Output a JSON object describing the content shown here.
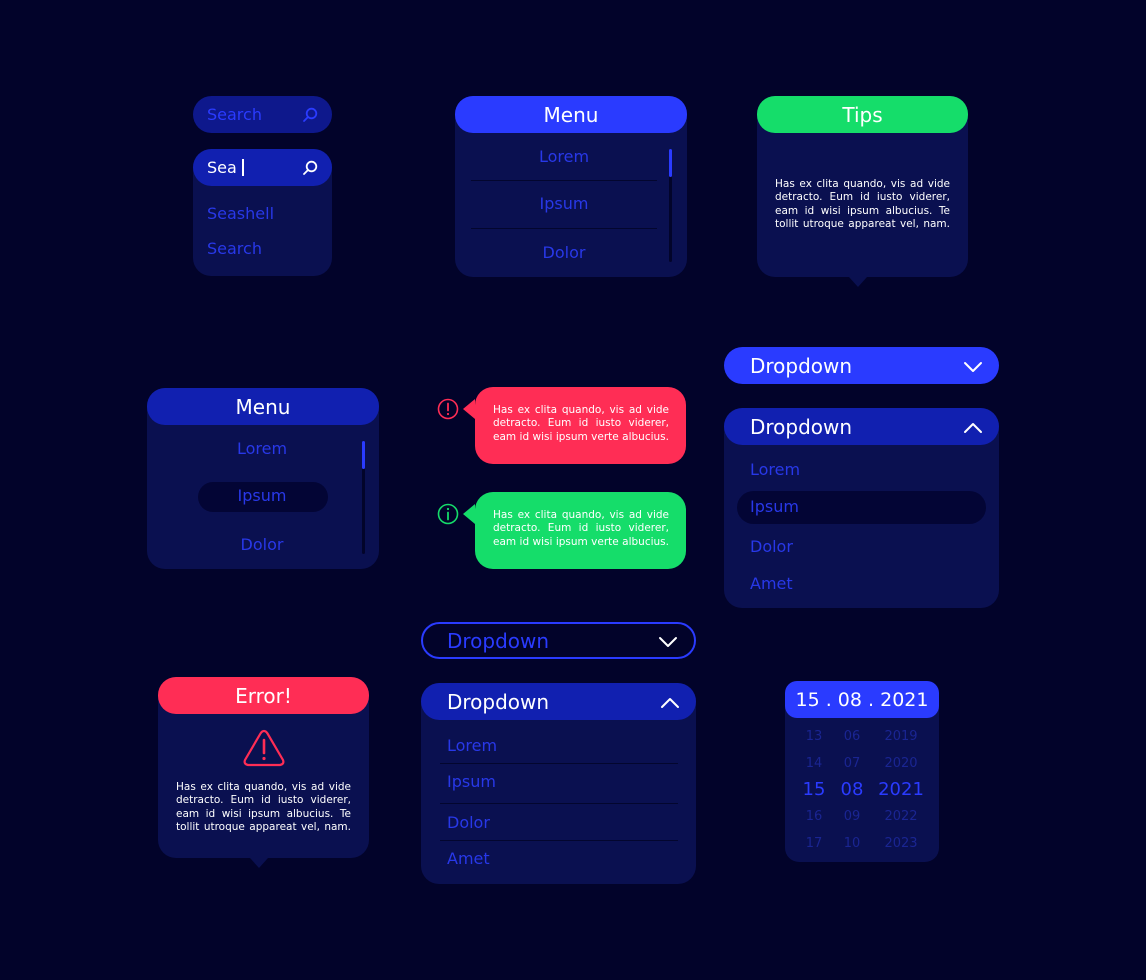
{
  "colors": {
    "background": "#02032a",
    "panel": "#0a1050",
    "primary_blue": "#2a3bff",
    "dark_blue": "#1120b0",
    "success_green": "#15dd6a",
    "error_red": "#ff2d55"
  },
  "search_idle": {
    "placeholder": "Search",
    "icon": "search-icon"
  },
  "search_active": {
    "value": "Sea",
    "icon": "search-icon",
    "suggestions": [
      "Seashell",
      "Search"
    ]
  },
  "menu_top": {
    "title": "Menu",
    "items": [
      "Lorem",
      "Ipsum",
      "Dolor"
    ]
  },
  "tips": {
    "title": "Tips",
    "body": "Has ex clita quando, vis ad vide detracto. Eum id iusto viderer, eam id wisi ipsum albucius. Te tollit utroque appareat vel, nam."
  },
  "menu_mid": {
    "title": "Menu",
    "items": [
      "Lorem",
      "Ipsum",
      "Dolor"
    ],
    "selected": "Ipsum"
  },
  "alert_error": {
    "icon": "exclamation-circle-icon",
    "body": "Has ex clita quando, vis ad vide detracto. Eum id iusto viderer, eam id wisi ipsum verte albucius."
  },
  "alert_info": {
    "icon": "info-circle-icon",
    "body": "Has ex clita quando, vis ad vide detracto. Eum id iusto viderer, eam id wisi ipsum verte albucius."
  },
  "dropdown_right_closed": {
    "label": "Dropdown",
    "icon": "chevron-down-icon"
  },
  "dropdown_right_open": {
    "label": "Dropdown",
    "icon": "chevron-up-icon",
    "items": [
      "Lorem",
      "Ipsum",
      "Dolor",
      "Amet"
    ],
    "selected": "Ipsum"
  },
  "dropdown_center_closed": {
    "label": "Dropdown",
    "icon": "chevron-down-icon"
  },
  "dropdown_center_open": {
    "label": "Dropdown",
    "icon": "chevron-up-icon",
    "items": [
      "Lorem",
      "Ipsum",
      "Dolor",
      "Amet"
    ]
  },
  "error_card": {
    "title": "Error!",
    "icon": "warning-triangle-icon",
    "body": "Has ex clita quando, vis ad vide detracto. Eum id iusto viderer, eam id wisi ipsum albucius. Te tollit utroque appareat vel, nam."
  },
  "date_picker": {
    "value": "15 . 08 . 2021",
    "days": [
      "13",
      "14",
      "15",
      "16",
      "17"
    ],
    "months": [
      "06",
      "07",
      "08",
      "09",
      "10"
    ],
    "years": [
      "2019",
      "2020",
      "2021",
      "2022",
      "2023"
    ],
    "selected_day": "15",
    "selected_month": "08",
    "selected_year": "2021"
  }
}
